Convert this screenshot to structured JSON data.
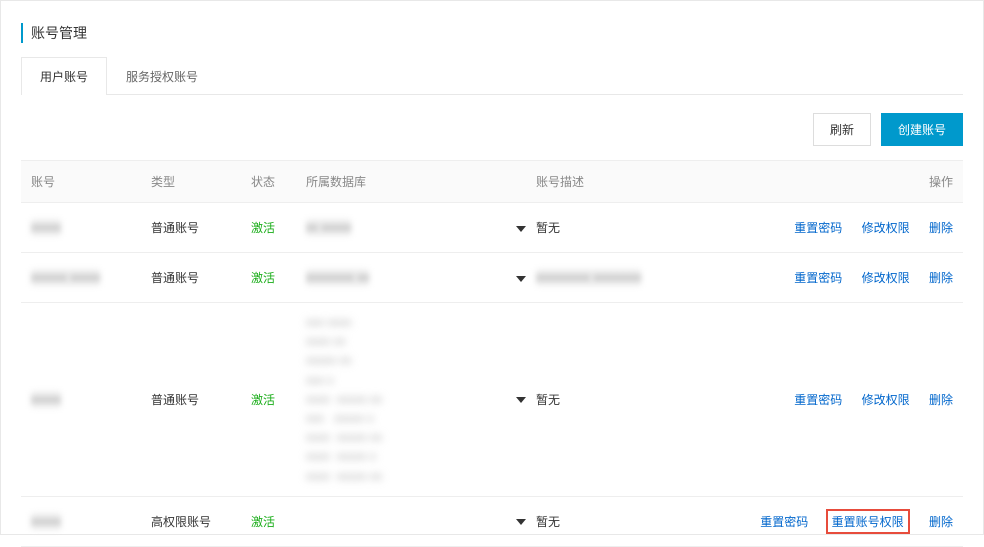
{
  "page": {
    "title": "账号管理"
  },
  "tabs": {
    "user_accounts": "用户账号",
    "service_accounts": "服务授权账号"
  },
  "toolbar": {
    "refresh": "刷新",
    "create": "创建账号"
  },
  "columns": {
    "account": "账号",
    "type": "类型",
    "status": "状态",
    "db": "所属数据库",
    "desc": "账号描述",
    "actions": "操作"
  },
  "status": {
    "active": "激活"
  },
  "types": {
    "normal": "普通账号",
    "high": "高权限账号"
  },
  "desc_none": "暂无",
  "actions": {
    "reset_password": "重置密码",
    "modify_permission": "修改权限",
    "reset_account_permission": "重置账号权限",
    "delete": "删除"
  },
  "rows": [
    {
      "account_placeholder": "xxxxx",
      "type": "normal",
      "db_placeholder": "xx xxxxx",
      "desc": "暂无",
      "action_set": "normal"
    },
    {
      "account_placeholder": "xxxxxx xxxxx",
      "type": "normal",
      "db_placeholder": "xxxxxxxx xx",
      "desc": "",
      "desc_placeholder": "xxxxxxxxx xxxxxxxx",
      "action_set": "normal"
    },
    {
      "account_placeholder": "xxxxx",
      "type": "normal",
      "db_placeholder": "multiline",
      "desc": "暂无",
      "action_set": "normal"
    },
    {
      "account_placeholder": "xxxxx",
      "type": "high",
      "db_placeholder": "",
      "desc": "暂无",
      "action_set": "high"
    }
  ]
}
